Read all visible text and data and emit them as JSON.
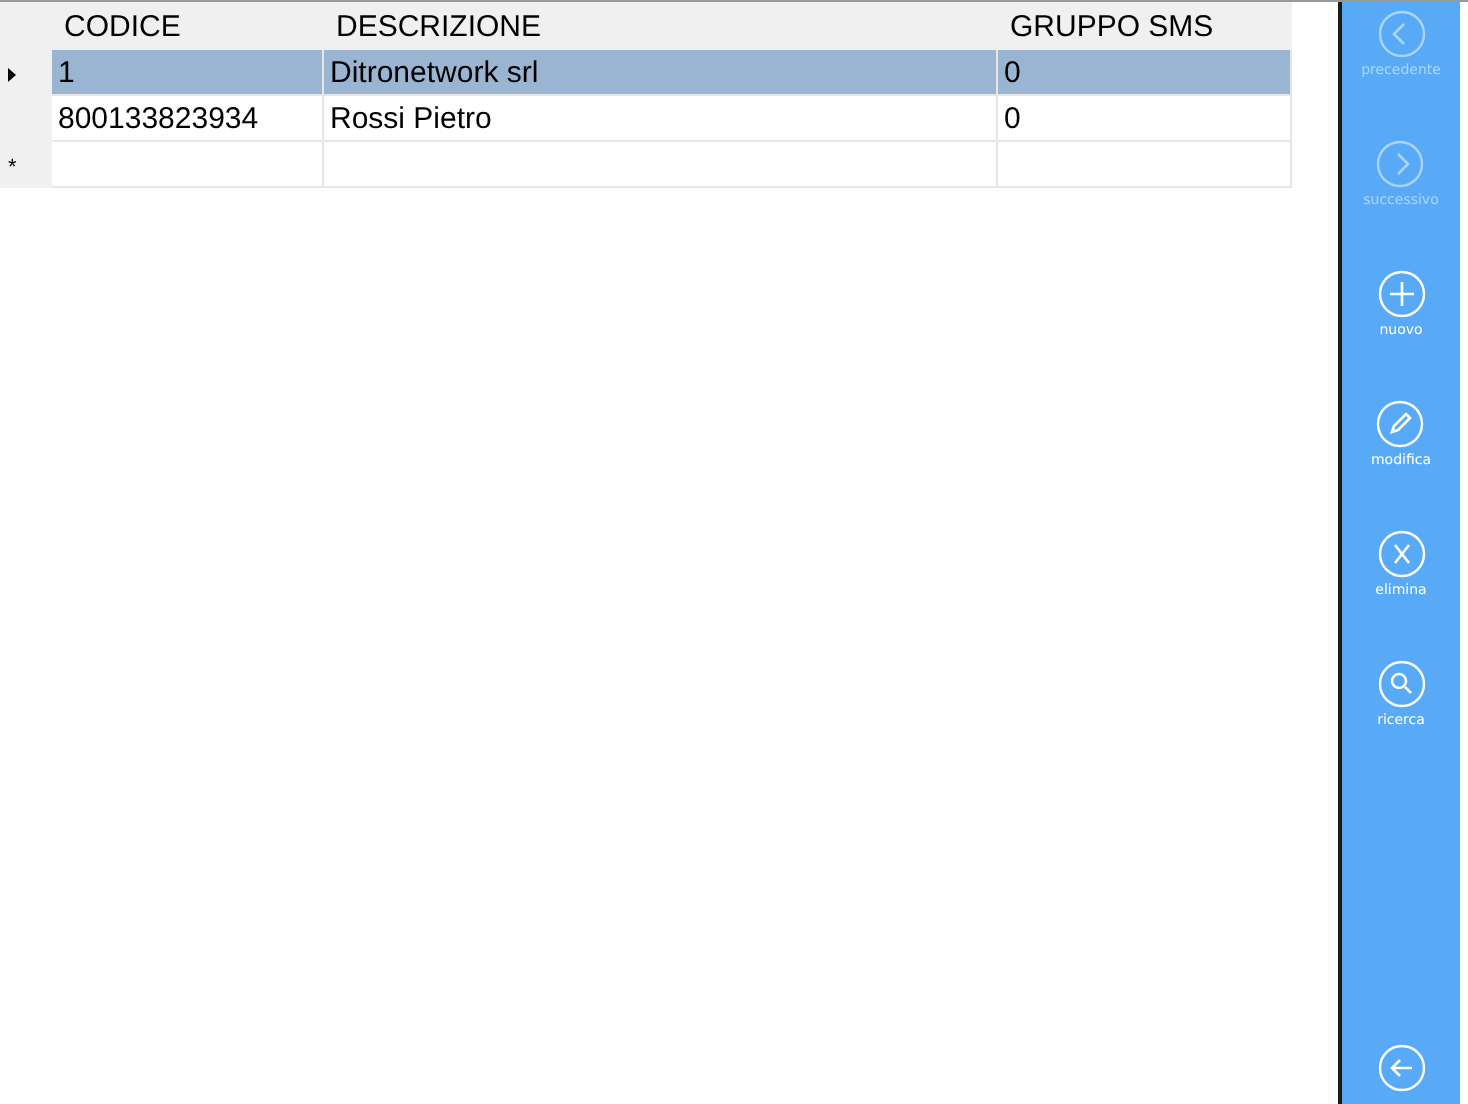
{
  "table": {
    "columns": [
      "CODICE",
      "DESCRIZIONE",
      "GRUPPO SMS"
    ],
    "rows": [
      {
        "cells": [
          "1",
          "Ditronetwork srl",
          "0"
        ],
        "selected": true
      },
      {
        "cells": [
          "800133823934",
          "Rossi Pietro",
          "0"
        ],
        "selected": false
      }
    ],
    "new_row_marker": "*"
  },
  "toolbar": {
    "buttons": [
      {
        "kind": "previous",
        "label": "precedente",
        "disabled": true
      },
      {
        "kind": "next",
        "label": "successivo",
        "disabled": true
      },
      {
        "kind": "add",
        "label": "nuovo",
        "disabled": false
      },
      {
        "kind": "edit",
        "label": "modifica",
        "disabled": false
      },
      {
        "kind": "delete",
        "label": "elimina",
        "disabled": false
      },
      {
        "kind": "search",
        "label": "ricerca",
        "disabled": false
      }
    ],
    "back_button": {
      "kind": "back"
    }
  }
}
